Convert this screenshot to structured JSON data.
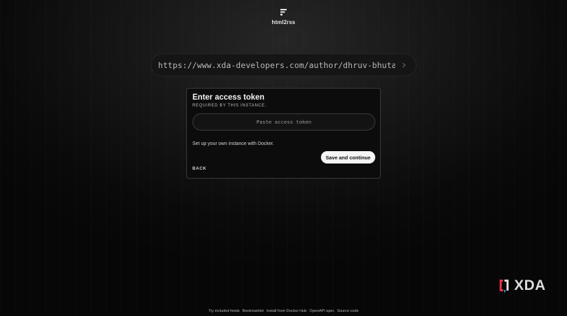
{
  "brand": {
    "name": "html2rss",
    "logo_icon": "rss-lines-icon"
  },
  "url_bar": {
    "value": "https://www.xda-developers.com/author/dhruv-bhutani/",
    "submit_icon": "chevron-right-icon"
  },
  "token_dialog": {
    "title": "Enter access token",
    "subtitle": "Required by this instance.",
    "token_placeholder": "Paste access token",
    "docker_note": "Set up your own instance with Docker.",
    "save_label": "Save and continue",
    "back_label": "Back"
  },
  "watermark": {
    "text": "XDA",
    "accent_red": "#e5333f",
    "accent_blue": "#3b8fd9"
  },
  "footer": {
    "links": [
      {
        "label": "Try included feeds"
      },
      {
        "label": "Bookmarklet"
      },
      {
        "label": "Install from Docker Hub"
      },
      {
        "label": "OpenAPI spec"
      },
      {
        "label": "Source code"
      }
    ]
  }
}
